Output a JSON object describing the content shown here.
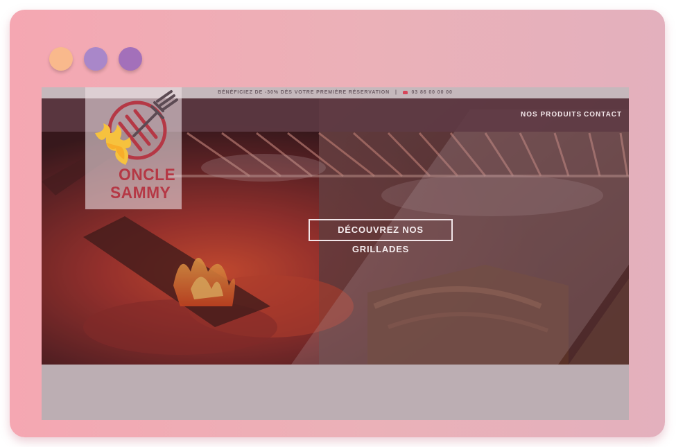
{
  "window": {
    "controls": [
      {
        "name": "orange-dot",
        "color": "#f9b98c"
      },
      {
        "name": "lavender-dot",
        "color": "#a987c9"
      },
      {
        "name": "purple-dot",
        "color": "#a370ba"
      }
    ]
  },
  "promo": {
    "text": "Bénéficiez de -30% dès votre première réservation",
    "separator": "|",
    "phone_icon": "phone-icon",
    "phone": "03 86 00 00 00"
  },
  "brand": {
    "line1": "ONCLE",
    "line2": "SAMMY",
    "icon": "grill-fork-flame-logo"
  },
  "nav": {
    "products": "Nos produits",
    "contact": "Contact"
  },
  "hero": {
    "cta": "Découvrez nos grillades",
    "background": "campfire-grill-photo"
  },
  "colors": {
    "brand_red": "#b53845",
    "flame_yellow": "#f6c23e",
    "frame_pink": "#f5a7b2"
  }
}
